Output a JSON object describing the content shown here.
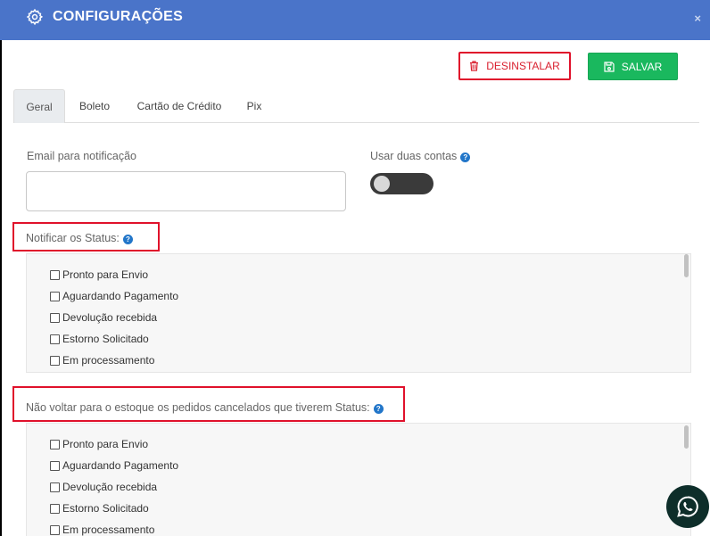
{
  "header": {
    "title": "CONFIGURAÇÕES",
    "close_label": "×"
  },
  "actions": {
    "uninstall_label": "DESINSTALAR",
    "save_label": "SALVAR"
  },
  "tabs": [
    {
      "label": "Geral",
      "active": true
    },
    {
      "label": "Boleto"
    },
    {
      "label": "Cartão de Crédito"
    },
    {
      "label": "Pix"
    }
  ],
  "form": {
    "email_label": "Email para notificação",
    "email_value": "",
    "two_accounts_label": "Usar duas contas",
    "two_accounts_on": false,
    "notify_status_label": "Notificar os Status:",
    "no_restock_label": "Não voltar para o estoque os pedidos cancelados que tiverem Status:",
    "help_glyph": "?"
  },
  "status_options": [
    "Pronto para Envio",
    "Aguardando Pagamento",
    "Devolução recebida",
    "Estorno Solicitado",
    "Em processamento"
  ],
  "colors": {
    "header_bg": "#4a74c9",
    "danger": "#e0112b",
    "success": "#1ab85e",
    "help": "#2276c9"
  },
  "icons": [
    "gear-icon",
    "trash-icon",
    "save-icon",
    "help-icon",
    "whatsapp-icon"
  ]
}
